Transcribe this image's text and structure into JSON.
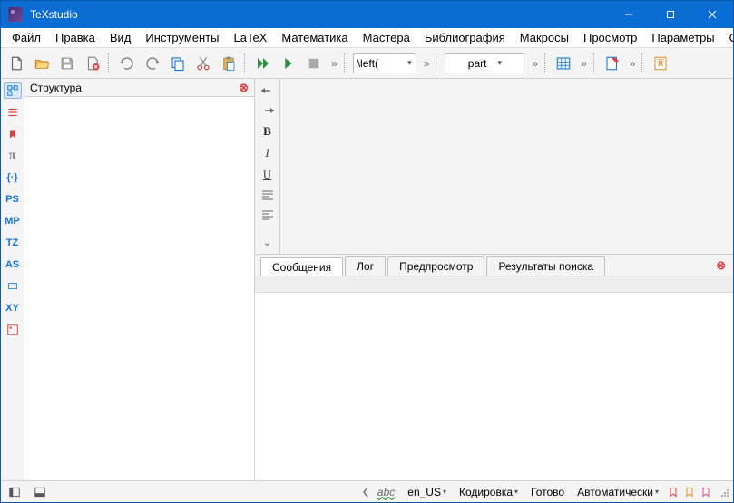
{
  "window": {
    "title": "TeXstudio"
  },
  "menu": {
    "items": [
      "Файл",
      "Правка",
      "Вид",
      "Инструменты",
      "LaTeX",
      "Математика",
      "Мастера",
      "Библиография",
      "Макросы",
      "Просмотр",
      "Параметры",
      "Справка"
    ]
  },
  "toolbar": {
    "combo_left": "\\left(",
    "combo_part": "part"
  },
  "structure": {
    "title": "Структура"
  },
  "sidestrip": {
    "labels": [
      "",
      "",
      "",
      "",
      "",
      "PS",
      "MP",
      "TZ",
      "AS",
      "",
      "XY",
      ""
    ]
  },
  "vformat": {
    "bold": "B",
    "italic": "I",
    "underline": "U"
  },
  "messages": {
    "tabs": [
      "Сообщения",
      "Лог",
      "Предпросмотр",
      "Результаты поиска"
    ]
  },
  "status": {
    "spell": "abc",
    "lang": "en_US",
    "encoding": "Кодировка",
    "ready": "Готово",
    "auto": "Автоматически"
  }
}
